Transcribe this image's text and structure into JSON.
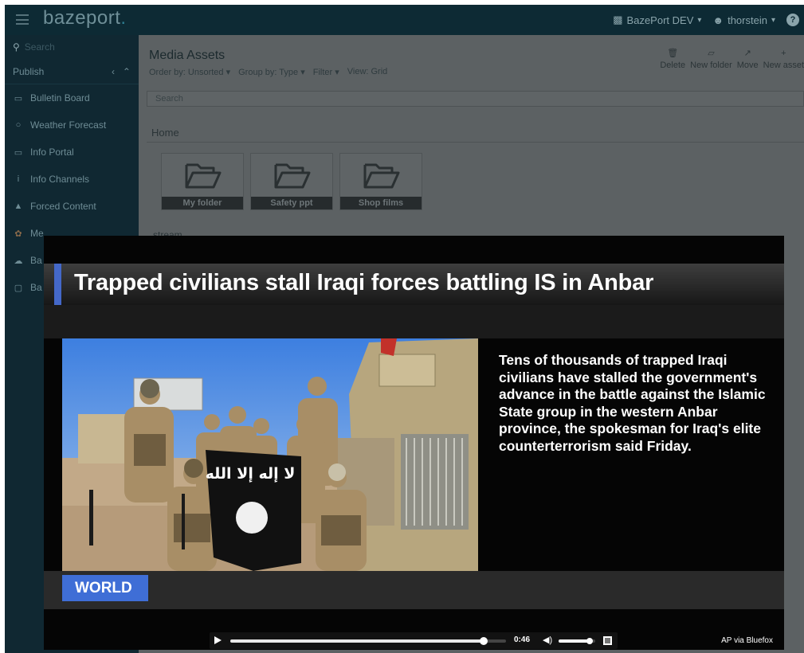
{
  "app": {
    "brand": "bazeport",
    "brand_dot": ".",
    "site_selector": "BazePort DEV",
    "user": "thorstein"
  },
  "sidebar": {
    "search_placeholder": "Search",
    "section": "Publish",
    "items": [
      {
        "label": "Bulletin Board",
        "icon": "bulletin-board-icon"
      },
      {
        "label": "Weather Forecast",
        "icon": "weather-icon"
      },
      {
        "label": "Info Portal",
        "icon": "info-portal-icon"
      },
      {
        "label": "Info Channels",
        "icon": "info-icon"
      },
      {
        "label": "Forced Content",
        "icon": "warning-icon"
      },
      {
        "label": "Me",
        "icon": "media-icon"
      },
      {
        "label": "Ba",
        "icon": "cloud-icon"
      },
      {
        "label": "Ba",
        "icon": "monitor-icon"
      }
    ]
  },
  "content": {
    "title": "Media Assets",
    "options": [
      "Order by: Unsorted",
      "Group by: Type",
      "Filter",
      "View: Grid"
    ],
    "toolbar": [
      "Delete",
      "New folder",
      "Move",
      "New asset"
    ],
    "search_placeholder": "Search",
    "breadcrumb": "Home",
    "folders": [
      "My folder",
      "Safety ppt",
      "Shop films"
    ],
    "stream_label": "stream"
  },
  "video": {
    "headline": "Trapped civilians stall Iraqi forces battling IS in Anbar",
    "summary": "Tens of thousands of trapped Iraqi civilians have stalled the government's advance in the battle against the Islamic State group in the western Anbar province, the spokesman for Iraq's elite counterterrorism said Friday.",
    "category": "WORLD",
    "time": "0:46",
    "credit": "AP via Bluefox",
    "progress": 0.92,
    "volume": 0.85,
    "flag_text": "لا إله إلا الله"
  },
  "colors": {
    "accent_blue": "#3f6ed6",
    "topbar": "#0d2a34",
    "sidebar": "#102832"
  }
}
